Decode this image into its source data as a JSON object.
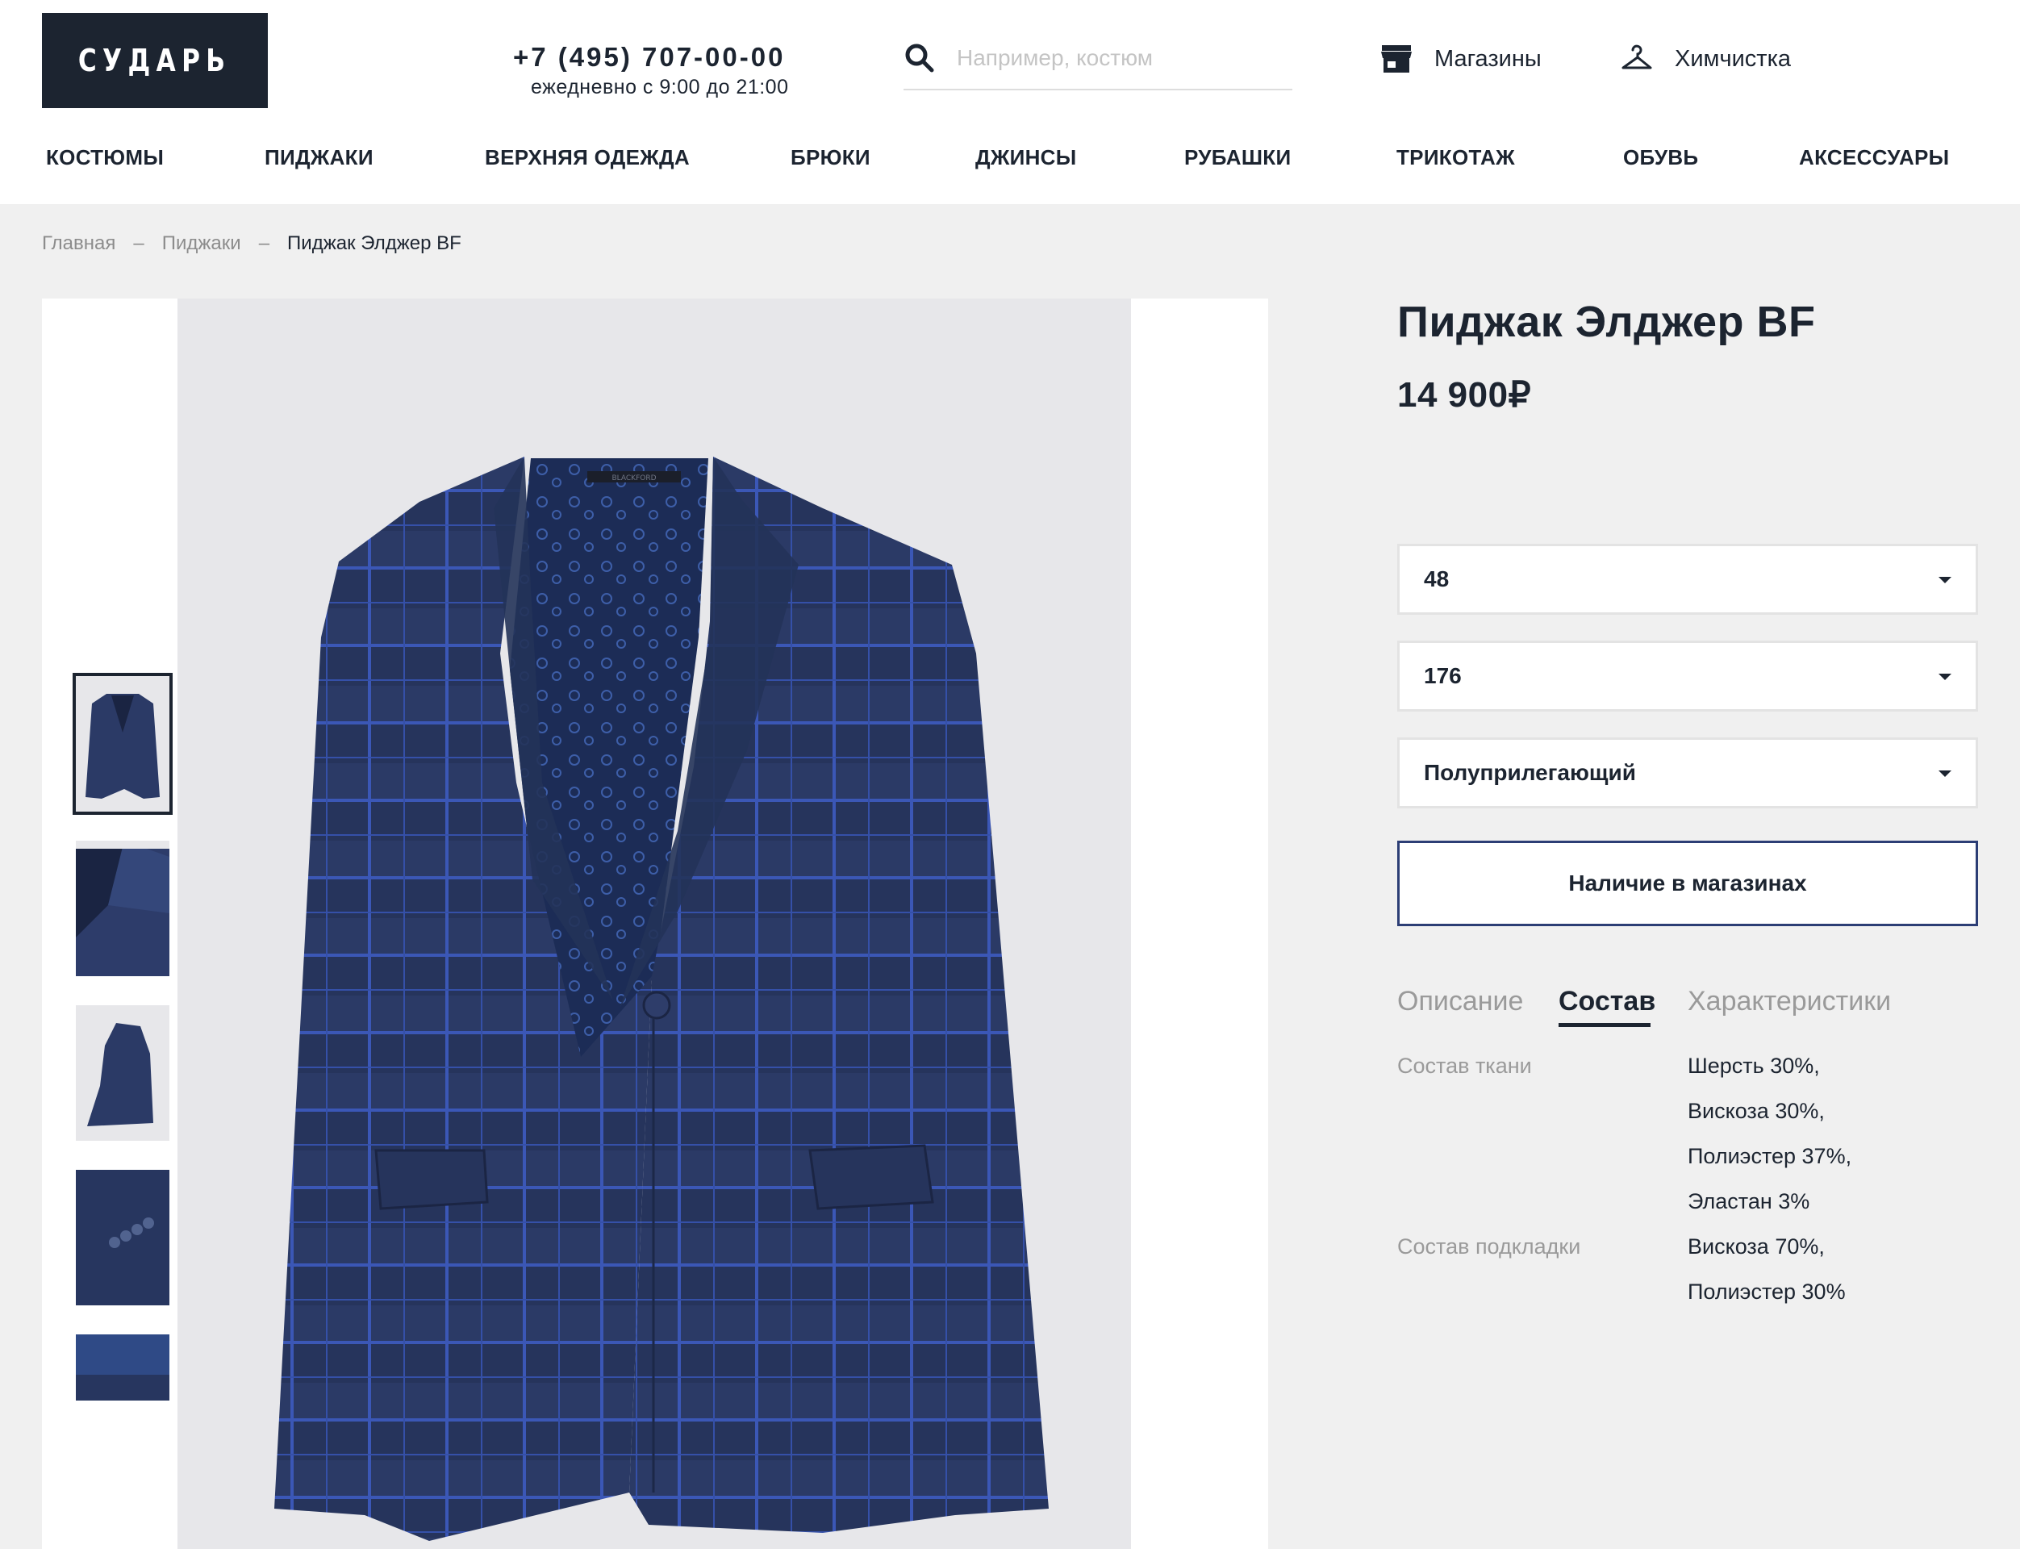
{
  "header": {
    "logo": "СУДАРЬ",
    "phone": "+7 (495) 707-00-00",
    "hours": "ежедневно с 9:00 до 21:00",
    "search_placeholder": "Например, костюм",
    "stores_label": "Магазины",
    "dry_cleaning_label": "Химчистка"
  },
  "nav": [
    "КОСТЮМЫ",
    "ПИДЖАКИ",
    "ВЕРХНЯЯ ОДЕЖДА",
    "БРЮКИ",
    "ДЖИНСЫ",
    "РУБАШКИ",
    "ТРИКОТАЖ",
    "ОБУВЬ",
    "АКСЕССУАРЫ"
  ],
  "breadcrumb": {
    "items": [
      "Главная",
      "Пиджаки",
      "Пиджак Элджер BF"
    ],
    "separator": "–"
  },
  "gallery": {
    "thumbnails": [
      "front-view",
      "lapel-detail",
      "side-view",
      "sleeve-buttons",
      "lining-detail"
    ],
    "active_index": 0,
    "label_text": "BLACKFORD"
  },
  "product": {
    "title": "Пиджак Элджер BF",
    "price": "14 900₽",
    "size": "48",
    "height": "176",
    "fit": "Полуприлегающий",
    "stock_button": "Наличие в магазинах"
  },
  "tabs": {
    "items": [
      "Описание",
      "Состав",
      "Характеристики"
    ],
    "active_index": 1
  },
  "composition": {
    "fabric_label": "Состав ткани",
    "fabric": [
      "Шерсть 30%,",
      "Вискоза 30%,",
      "Полиэстер 37%,",
      "Эластан 3%"
    ],
    "lining_label": "Состав подкладки",
    "lining": [
      "Вискоза 70%,",
      "Полиэстер 30%"
    ]
  },
  "colors": {
    "dark": "#1c2430",
    "accent_border": "#2c3e75",
    "muted": "#9a9a9a",
    "page_bg": "#f0f0f0",
    "jacket": "#2b3a66"
  }
}
